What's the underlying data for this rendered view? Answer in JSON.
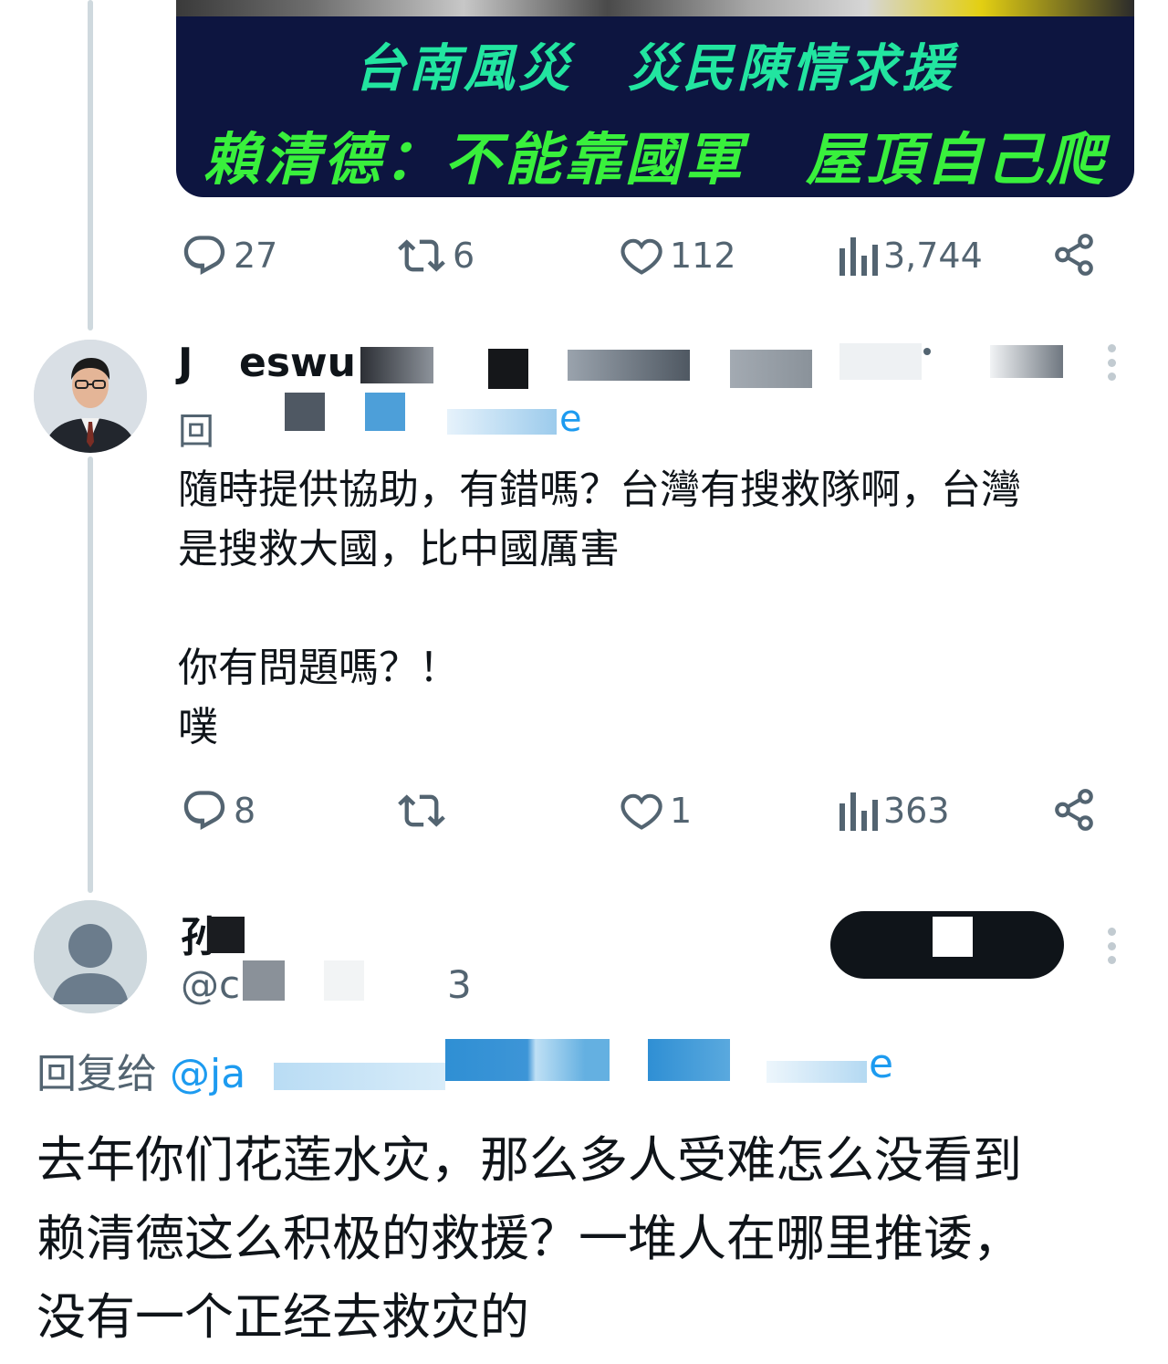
{
  "media": {
    "line1": "台南風災　災民陳情求援",
    "line2": "賴清德：不能靠國軍　屋頂自己爬"
  },
  "post1": {
    "replies": "27",
    "reposts": "6",
    "likes": "112",
    "views": "3,744"
  },
  "post2": {
    "author_name_visible": "J",
    "author_name_visible2": "eswu",
    "reply_prefix": "回",
    "reply_suffix": "e",
    "body": "隨時提供協助，有錯嗎？台灣有搜救隊啊，台灣\n是搜救大國，比中國厲害\n\n你有問題嗎？！\n噗",
    "replies": "8",
    "reposts": "",
    "likes": "1",
    "views": "363"
  },
  "post3": {
    "author_name_visible": "孙",
    "handle_visible": "@c",
    "handle_tail": "3",
    "reply_prefix": "回复给",
    "reply_mention_visible": "@ja",
    "reply_mention_tail": "e",
    "body": "去年你们花莲水灾，那么多人受难怎么没看到\n赖清德这么积极的救援？一堆人在哪里推诿，\n没有一个正经去救灾的"
  },
  "colors": {
    "text_primary": "#0f1419",
    "text_secondary": "#536471",
    "accent_link": "#1d9bf0",
    "thread_line": "#cfd9de",
    "media_background": "#0d1540",
    "media_line1": "#22e5a0",
    "media_line2": "#39f03c"
  },
  "icons": [
    "reply-icon",
    "repost-icon",
    "like-icon",
    "views-icon",
    "share-icon",
    "more-icon",
    "default-avatar-icon"
  ]
}
